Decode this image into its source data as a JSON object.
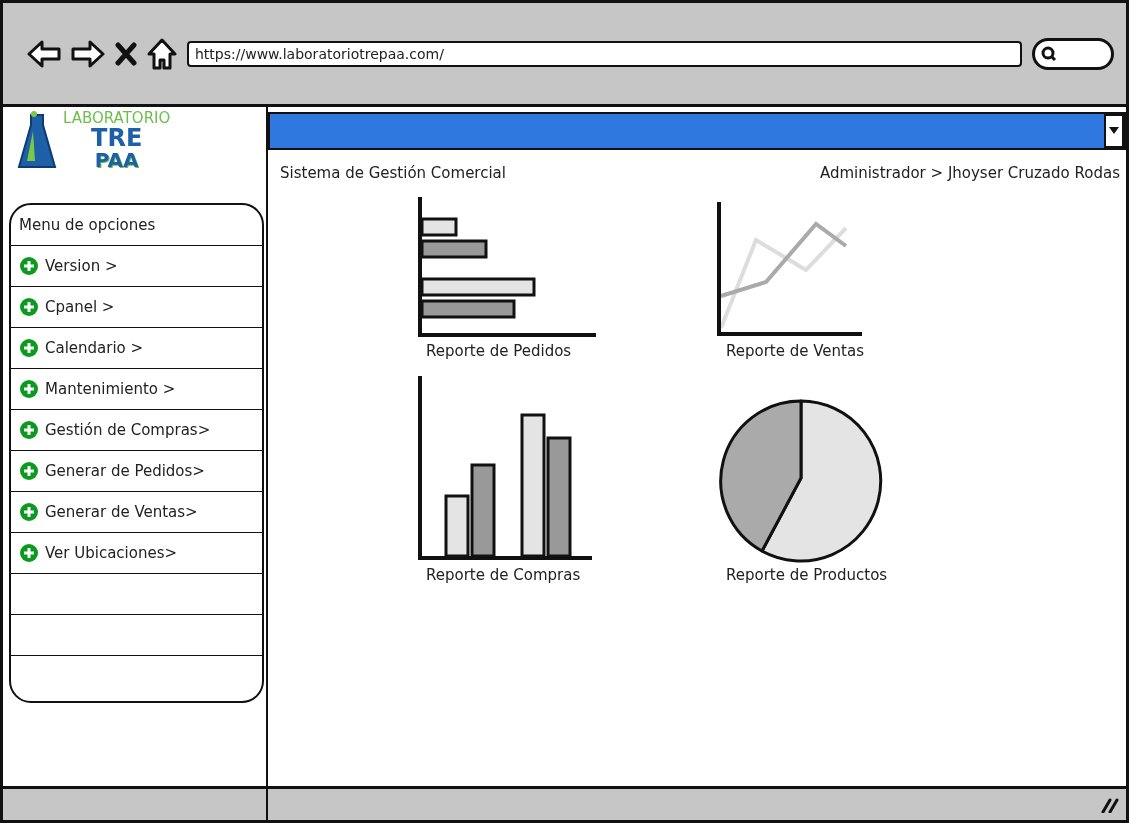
{
  "browser": {
    "url": "https://www.laboratoriotrepaa.com/"
  },
  "logo": {
    "line_1": "LABORATORIO",
    "line_2": "TRE",
    "line_3": "PAA"
  },
  "header": {
    "title": "Sistema de Gestión Comercial",
    "user": "Administrador > Jhoyser Cruzado Rodas"
  },
  "menu": {
    "title": "Menu de opciones",
    "items": [
      {
        "label": "Version >"
      },
      {
        "label": "Cpanel >"
      },
      {
        "label": "Calendario >"
      },
      {
        "label": "Mantenimiento >"
      },
      {
        "label": "Gestión de Compras>"
      },
      {
        "label": "Generar de Pedidos>"
      },
      {
        "label": "Generar de Ventas>"
      },
      {
        "label": "Ver Ubicaciones>"
      }
    ]
  },
  "reports": [
    {
      "kind": "hbar",
      "label": "Reporte de Pedidos"
    },
    {
      "kind": "line",
      "label": "Reporte de Ventas"
    },
    {
      "kind": "vbar",
      "label": "Reporte de Compras"
    },
    {
      "kind": "pie",
      "label": "Reporte de Productos"
    }
  ]
}
